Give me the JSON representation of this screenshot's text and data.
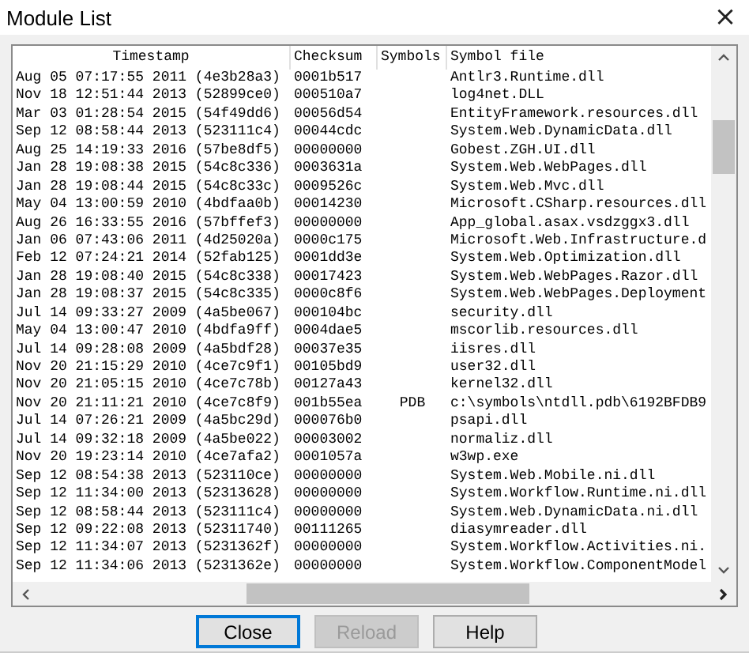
{
  "window": {
    "title": "Module List",
    "close": "×"
  },
  "table": {
    "columns": [
      {
        "label": "Timestamp"
      },
      {
        "label": "Checksum"
      },
      {
        "label": "Symbols"
      },
      {
        "label": "Symbol file"
      }
    ],
    "rows": [
      {
        "timestamp": "Aug 05 07:17:55 2011 (4e3b28a3)",
        "checksum": "0001b517",
        "symbols": "",
        "symbol_file": "Antlr3.Runtime.dll"
      },
      {
        "timestamp": "Nov 18 12:51:44 2013 (52899ce0)",
        "checksum": "000510a7",
        "symbols": "",
        "symbol_file": "log4net.DLL"
      },
      {
        "timestamp": "Mar 03 01:28:54 2015 (54f49dd6)",
        "checksum": "00056d54",
        "symbols": "",
        "symbol_file": "EntityFramework.resources.dll"
      },
      {
        "timestamp": "Sep 12 08:58:44 2013 (523111c4)",
        "checksum": "00044cdc",
        "symbols": "",
        "symbol_file": "System.Web.DynamicData.dll"
      },
      {
        "timestamp": "Aug 25 14:19:33 2016 (57be8df5)",
        "checksum": "00000000",
        "symbols": "",
        "symbol_file": "Gobest.ZGH.UI.dll"
      },
      {
        "timestamp": "Jan 28 19:08:38 2015 (54c8c336)",
        "checksum": "0003631a",
        "symbols": "",
        "symbol_file": "System.Web.WebPages.dll"
      },
      {
        "timestamp": "Jan 28 19:08:44 2015 (54c8c33c)",
        "checksum": "0009526c",
        "symbols": "",
        "symbol_file": "System.Web.Mvc.dll"
      },
      {
        "timestamp": "May 04 13:00:59 2010 (4bdfaa0b)",
        "checksum": "00014230",
        "symbols": "",
        "symbol_file": "Microsoft.CSharp.resources.dll"
      },
      {
        "timestamp": "Aug 26 16:33:55 2016 (57bffef3)",
        "checksum": "00000000",
        "symbols": "",
        "symbol_file": "App_global.asax.vsdzggx3.dll"
      },
      {
        "timestamp": "Jan 06 07:43:06 2011 (4d25020a)",
        "checksum": "0000c175",
        "symbols": "",
        "symbol_file": "Microsoft.Web.Infrastructure.d"
      },
      {
        "timestamp": "Feb 12 07:24:21 2014 (52fab125)",
        "checksum": "0001dd3e",
        "symbols": "",
        "symbol_file": "System.Web.Optimization.dll"
      },
      {
        "timestamp": "Jan 28 19:08:40 2015 (54c8c338)",
        "checksum": "00017423",
        "symbols": "",
        "symbol_file": "System.Web.WebPages.Razor.dll"
      },
      {
        "timestamp": "Jan 28 19:08:37 2015 (54c8c335)",
        "checksum": "0000c8f6",
        "symbols": "",
        "symbol_file": "System.Web.WebPages.Deployment"
      },
      {
        "timestamp": "Jul 14 09:33:27 2009 (4a5be067)",
        "checksum": "000104bc",
        "symbols": "",
        "symbol_file": "security.dll"
      },
      {
        "timestamp": "May 04 13:00:47 2010 (4bdfa9ff)",
        "checksum": "0004dae5",
        "symbols": "",
        "symbol_file": "mscorlib.resources.dll"
      },
      {
        "timestamp": "Jul 14 09:28:08 2009 (4a5bdf28)",
        "checksum": "00037e35",
        "symbols": "",
        "symbol_file": "iisres.dll"
      },
      {
        "timestamp": "Nov 20 21:15:29 2010 (4ce7c9f1)",
        "checksum": "00105bd9",
        "symbols": "",
        "symbol_file": "user32.dll"
      },
      {
        "timestamp": "Nov 20 21:05:15 2010 (4ce7c78b)",
        "checksum": "00127a43",
        "symbols": "",
        "symbol_file": "kernel32.dll"
      },
      {
        "timestamp": "Nov 20 21:11:21 2010 (4ce7c8f9)",
        "checksum": "001b55ea",
        "symbols": "PDB",
        "symbol_file": "c:\\symbols\\ntdll.pdb\\6192BFDB9"
      },
      {
        "timestamp": "Jul 14 07:26:21 2009 (4a5bc29d)",
        "checksum": "000076b0",
        "symbols": "",
        "symbol_file": "psapi.dll"
      },
      {
        "timestamp": "Jul 14 09:32:18 2009 (4a5be022)",
        "checksum": "00003002",
        "symbols": "",
        "symbol_file": "normaliz.dll"
      },
      {
        "timestamp": "Nov 20 19:23:14 2010 (4ce7afa2)",
        "checksum": "0001057a",
        "symbols": "",
        "symbol_file": "w3wp.exe"
      },
      {
        "timestamp": "Sep 12 08:54:38 2013 (523110ce)",
        "checksum": "00000000",
        "symbols": "",
        "symbol_file": "System.Web.Mobile.ni.dll"
      },
      {
        "timestamp": "Sep 12 11:34:00 2013 (52313628)",
        "checksum": "00000000",
        "symbols": "",
        "symbol_file": "System.Workflow.Runtime.ni.dll"
      },
      {
        "timestamp": "Sep 12 08:58:44 2013 (523111c4)",
        "checksum": "00000000",
        "symbols": "",
        "symbol_file": "System.Web.DynamicData.ni.dll"
      },
      {
        "timestamp": "Sep 12 09:22:08 2013 (52311740)",
        "checksum": "00111265",
        "symbols": "",
        "symbol_file": "diasymreader.dll"
      },
      {
        "timestamp": "Sep 12 11:34:07 2013 (5231362f)",
        "checksum": "00000000",
        "symbols": "",
        "symbol_file": "System.Workflow.Activities.ni."
      },
      {
        "timestamp": "Sep 12 11:34:06 2013 (5231362e)",
        "checksum": "00000000",
        "symbols": "",
        "symbol_file": "System.Workflow.ComponentModel"
      }
    ]
  },
  "buttons": [
    {
      "label": "Close",
      "disabled": false,
      "focused": true
    },
    {
      "label": "Reload",
      "disabled": true,
      "focused": false
    },
    {
      "label": "Help",
      "disabled": false,
      "focused": false
    }
  ]
}
